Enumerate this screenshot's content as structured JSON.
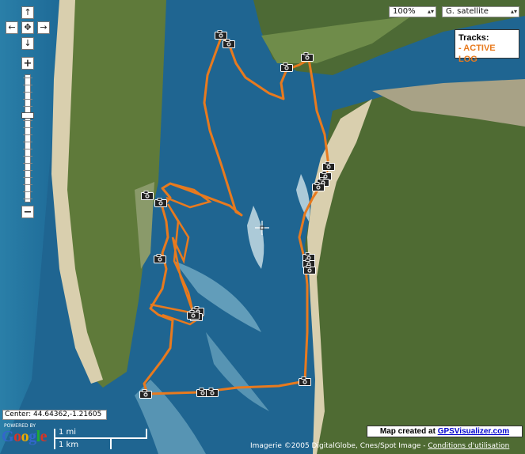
{
  "map": {
    "zoom_value": "100%",
    "map_type": "G. satellite",
    "track_color": "#e87a1e",
    "water_color": "#1d5e86",
    "land_color": "#5f7a3a"
  },
  "legend": {
    "title": "Tracks:",
    "item": "- ACTIVE LOG"
  },
  "controls": {
    "pan_up": "↑",
    "pan_left": "←",
    "pan_center": "✥",
    "pan_right": "→",
    "pan_down": "↓",
    "zoom_in": "+",
    "zoom_out": "−"
  },
  "status": {
    "center": "Center: 44.64362,-1.21605",
    "powered_by": "POWERED BY",
    "google": [
      "G",
      "o",
      "o",
      "g",
      "l",
      "e"
    ],
    "scale_mi": "1 mi",
    "scale_km": "1 km"
  },
  "credit": {
    "prefix": "Map created at ",
    "link": "GPSVisualizer.com"
  },
  "imagery": {
    "text": "Imagerie ©2005 DigitalGlobe, Cnes/Spot Image - ",
    "terms": "Conditions d'utilisation"
  },
  "icons": [
    "camera-icon",
    "crosshair-icon"
  ]
}
